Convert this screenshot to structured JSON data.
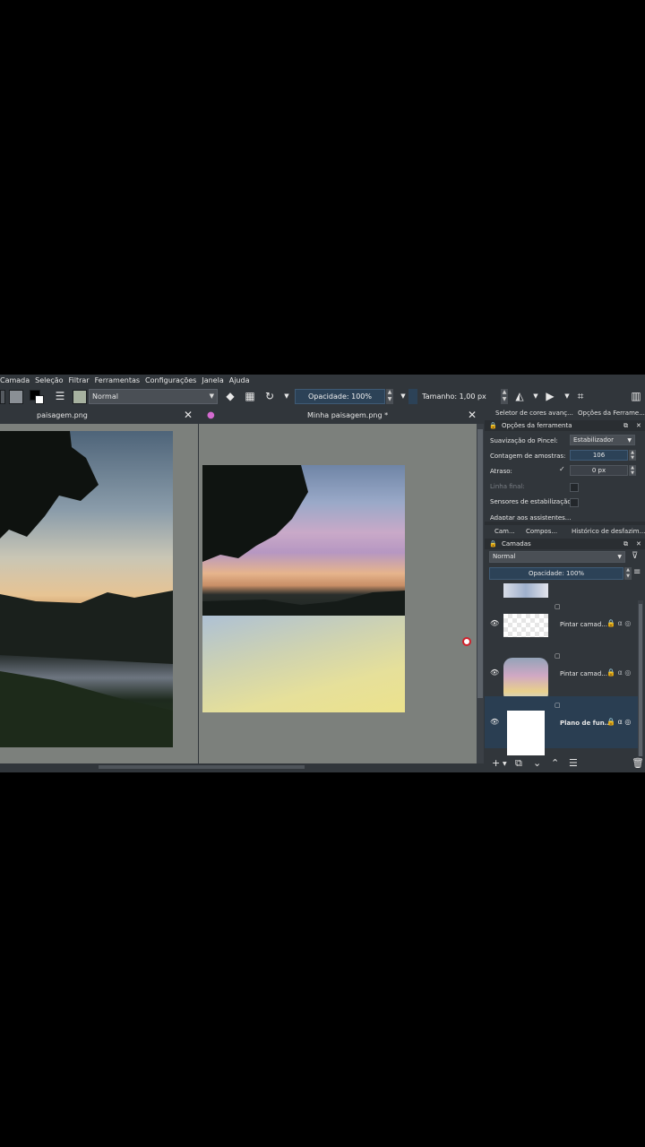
{
  "menu": [
    "Camada",
    "Seleção",
    "Filtrar",
    "Ferramentas",
    "Configurações",
    "Janela",
    "Ajuda"
  ],
  "toolbar": {
    "blend_mode": "Normal",
    "opacity": "Opacidade: 100%",
    "size": "Tamanho: 1,00 px",
    "colors": {
      "foreground": "#000000",
      "background": "#ffffff",
      "swatch": "#8a8f95"
    }
  },
  "tabs": {
    "left": "paisagem.png",
    "right": "Minha paisagem.png *"
  },
  "docker": {
    "tabs": [
      "Seletor de cores avanç...",
      "Opções da Ferrame..."
    ],
    "tool_options_title": "Opções da ferramenta",
    "smoothing_label": "Suavização do Pincel:",
    "smoothing_value": "Estabilizador",
    "sample_count_label": "Contagem de amostras:",
    "sample_count_value": "106",
    "delay_label": "Atraso:",
    "delay_value": "0 px",
    "finish_line_label": "Linha final:",
    "stabilize_sensors_label": "Sensores de estabilização:",
    "scale_label": "Adaptar aos assistentes...",
    "bottom_tabs": [
      "Cam...",
      "Compos...",
      "Histórico de desfazim..."
    ],
    "layers_title": "Camadas",
    "layers_blend": "Normal",
    "layers_opacity": "Opacidade:  100%"
  },
  "layers": [
    {
      "name": "Pintar camad...",
      "selected": false
    },
    {
      "name": "Pintar camad...",
      "selected": false
    },
    {
      "name": "Plano de fun...",
      "selected": true
    }
  ]
}
